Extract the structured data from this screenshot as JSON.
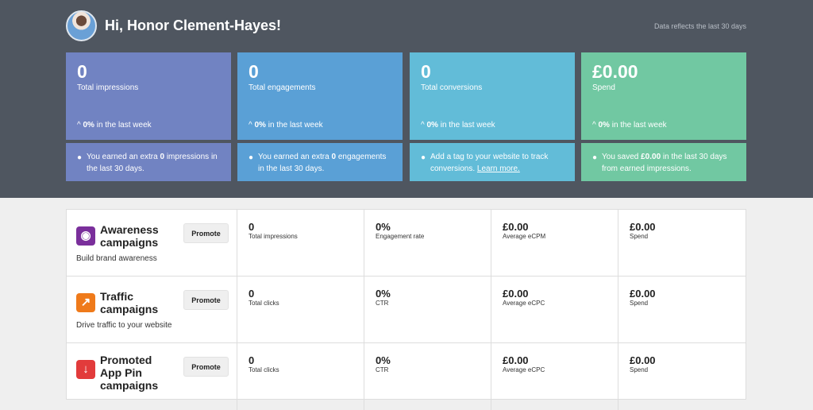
{
  "header": {
    "greeting": "Hi, Honor Clement-Hayes!",
    "data_note": "Data reflects the last 30 days"
  },
  "cards": [
    {
      "value": "0",
      "label": "Total impressions",
      "trend_pct": "0%",
      "trend_text": " in the last week",
      "tip_pre": "You earned an extra ",
      "tip_bold": "0",
      "tip_post": " impressions in the last 30 days.",
      "color": "#7183c2"
    },
    {
      "value": "0",
      "label": "Total engagements",
      "trend_pct": "0%",
      "trend_text": " in the last week",
      "tip_pre": "You earned an extra ",
      "tip_bold": "0",
      "tip_post": " engagements in the last 30 days.",
      "color": "#5aa0d6"
    },
    {
      "value": "0",
      "label": "Total conversions",
      "trend_pct": "0%",
      "trend_text": " in the last week",
      "tip_pre": "Add a tag to your website to track conversions. ",
      "tip_link": "Learn more.",
      "color": "#62bcd8"
    },
    {
      "value": "£0.00",
      "label": "Spend",
      "trend_pct": "0%",
      "trend_text": " in the last week",
      "tip_pre": "You saved ",
      "tip_bold": "£0.00",
      "tip_post": " in the last 30 days from earned impressions.",
      "color": "#71c8a2"
    }
  ],
  "campaigns": [
    {
      "name": "Awareness campaigns",
      "desc": "Build brand awareness",
      "icon": "eye-icon",
      "icon_color": "#7a2f9b",
      "promote": "Promote",
      "metrics": [
        {
          "value": "0",
          "label": "Total impressions"
        },
        {
          "value": "0%",
          "label": "Engagement rate"
        },
        {
          "value": "£0.00",
          "label": "Average eCPM"
        },
        {
          "value": "£0.00",
          "label": "Spend"
        }
      ]
    },
    {
      "name": "Traffic campaigns",
      "desc": "Drive traffic to your website",
      "icon": "arrow-up-right-icon",
      "icon_color": "#ef7a1a",
      "promote": "Promote",
      "metrics": [
        {
          "value": "0",
          "label": "Total clicks"
        },
        {
          "value": "0%",
          "label": "CTR"
        },
        {
          "value": "£0.00",
          "label": "Average eCPC"
        },
        {
          "value": "£0.00",
          "label": "Spend"
        }
      ]
    },
    {
      "name": "Promoted App Pin campaigns",
      "desc": "",
      "icon": "download-icon",
      "icon_color": "#e23b3b",
      "promote": "Promote",
      "metrics": [
        {
          "value": "0",
          "label": "Total clicks"
        },
        {
          "value": "0%",
          "label": "CTR"
        },
        {
          "value": "£0.00",
          "label": "Average eCPC"
        },
        {
          "value": "£0.00",
          "label": "Spend"
        }
      ]
    }
  ]
}
